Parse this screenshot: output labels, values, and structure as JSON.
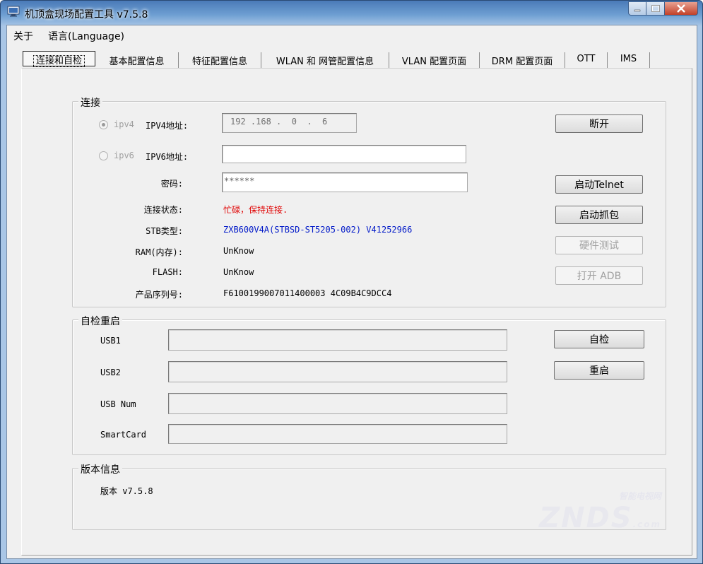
{
  "window": {
    "title": "机顶盒现场配置工具 v7.5.8"
  },
  "menu": {
    "about": "关于",
    "language": "语言(Language)"
  },
  "tabs": [
    {
      "label": "连接和自检"
    },
    {
      "label": "基本配置信息"
    },
    {
      "label": "特征配置信息"
    },
    {
      "label": "WLAN 和 网管配置信息"
    },
    {
      "label": "VLAN 配置页面"
    },
    {
      "label": "DRM 配置页面"
    },
    {
      "label": "OTT"
    },
    {
      "label": "IMS"
    }
  ],
  "connect": {
    "group_title": "连接",
    "ipv4_radio": "ipv4",
    "ipv4_label": "IPV4地址:",
    "ipv4_value": "192 .168 .  0  .  6",
    "ipv6_radio": "ipv6",
    "ipv6_label": "IPV6地址:",
    "ipv6_value": "",
    "password_label": "密码:",
    "password_value": "******",
    "status_label": "连接状态:",
    "status_value": "忙碌，保持连接.",
    "stb_label": "STB类型:",
    "stb_value": "ZXB600V4A(STBSD-ST5205-002) V41252966",
    "ram_label": "RAM(内存):",
    "ram_value": "UnKnow",
    "flash_label": "FLASH:",
    "flash_value": "UnKnow",
    "serial_label": "产品序列号:",
    "serial_value": "F6100199007011400003 4C09B4C9DCC4",
    "buttons": {
      "disconnect": "断开",
      "telnet": "启动Telnet",
      "capture": "启动抓包",
      "hardware_test": "硬件测试",
      "open_adb": "打开 ADB"
    }
  },
  "selftest": {
    "group_title": "自检重启",
    "usb1_label": "USB1",
    "usb2_label": "USB2",
    "usbnum_label": "USB Num",
    "smartcard_label": "SmartCard",
    "buttons": {
      "selftest": "自检",
      "reboot": "重启"
    }
  },
  "version": {
    "group_title": "版本信息",
    "text": "版本 v7.5.8"
  },
  "watermark": {
    "main": "ZNDS",
    "sub": ".com",
    "top": "智能电视网"
  }
}
